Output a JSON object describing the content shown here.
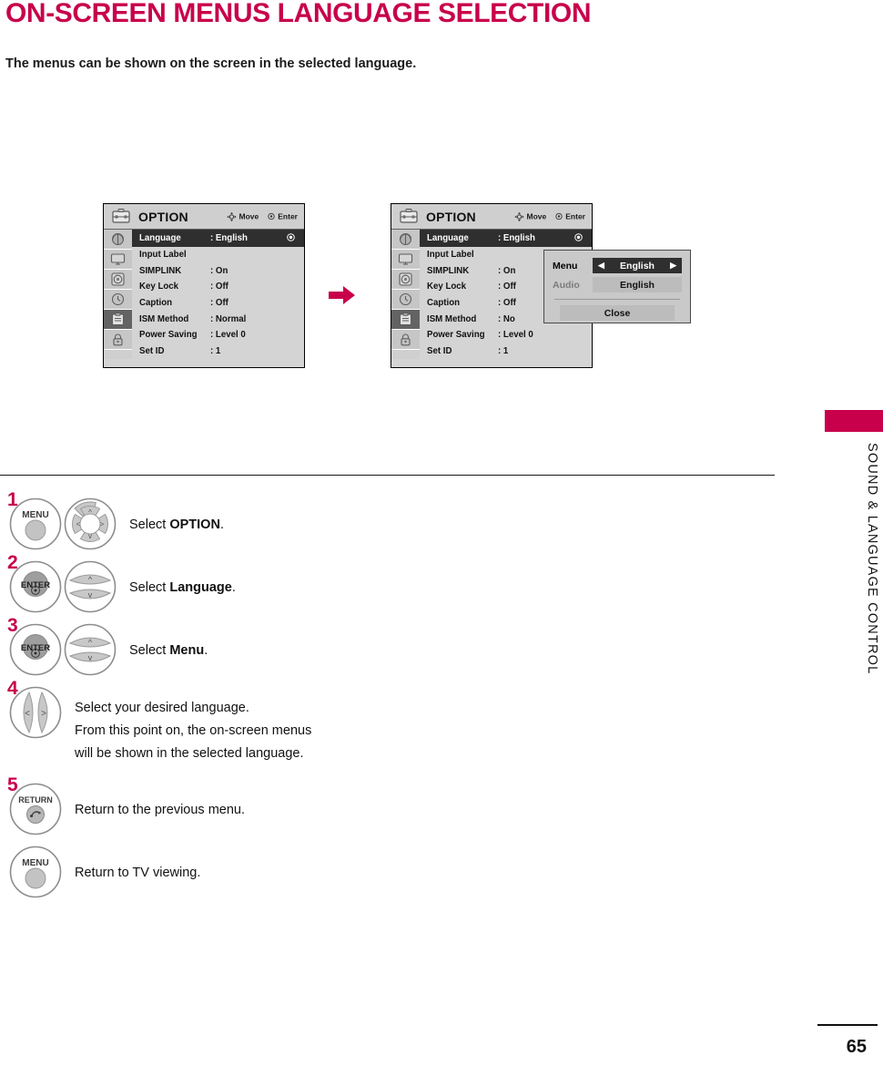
{
  "page": {
    "title": "ON-SCREEN MENUS LANGUAGE SELECTION",
    "subtitle": "The menus can be shown on the screen in the selected language.",
    "side_tab_text": "SOUND & LANGUAGE CONTROL",
    "page_number": "65",
    "accent_color": "#c8004b"
  },
  "osd": {
    "title": "OPTION",
    "hints": {
      "move": "Move",
      "enter": "Enter"
    },
    "rail_icons": [
      "picture-icon",
      "screen-icon",
      "audio-icon",
      "time-icon",
      "option-icon",
      "lock-icon"
    ],
    "rows": [
      {
        "label": "Language",
        "value": ": English",
        "highlighted": true
      },
      {
        "label": "Input Label",
        "value": "",
        "highlighted": false
      },
      {
        "label": "SIMPLINK",
        "value": ": On",
        "highlighted": false
      },
      {
        "label": "Key Lock",
        "value": ": Off",
        "highlighted": false
      },
      {
        "label": "Caption",
        "value": ": Off",
        "highlighted": false
      },
      {
        "label": "ISM Method",
        "value": ": Normal",
        "highlighted": false
      },
      {
        "label": "Power Saving",
        "value": ": Level 0",
        "highlighted": false
      },
      {
        "label": "Set ID",
        "value": ": 1",
        "highlighted": false
      }
    ],
    "rows_right": [
      {
        "label": "Language",
        "value": ": English",
        "highlighted": true
      },
      {
        "label": "Input Label",
        "value": "",
        "highlighted": false
      },
      {
        "label": "SIMPLINK",
        "value": ": On",
        "highlighted": false
      },
      {
        "label": "Key Lock",
        "value": ": Off",
        "highlighted": false
      },
      {
        "label": "Caption",
        "value": ": Off",
        "highlighted": false
      },
      {
        "label": "ISM Method",
        "value": ": No",
        "highlighted": false
      },
      {
        "label": "Power Saving",
        "value": ": Level 0",
        "highlighted": false
      },
      {
        "label": "Set ID",
        "value": ": 1",
        "highlighted": false
      }
    ]
  },
  "popup": {
    "menu_label": "Menu",
    "menu_value": "English",
    "audio_label": "Audio",
    "audio_value": "English",
    "close_label": "Close",
    "left_arrow": "◀",
    "right_arrow": "▶"
  },
  "steps": [
    {
      "num": "1",
      "buttons": [
        "MENU",
        "nav-wheel-4way"
      ],
      "text_prefix": "Select ",
      "text_bold": "OPTION",
      "text_suffix": "."
    },
    {
      "num": "2",
      "buttons": [
        "ENTER",
        "nav-updown"
      ],
      "text_prefix": "Select ",
      "text_bold": "Language",
      "text_suffix": "."
    },
    {
      "num": "3",
      "buttons": [
        "ENTER",
        "nav-updown"
      ],
      "text_prefix": "Select ",
      "text_bold": "Menu",
      "text_suffix": "."
    },
    {
      "num": "4",
      "buttons": [
        "nav-leftright"
      ],
      "line1": "Select your desired language.",
      "line2": "From this point on, the on-screen menus",
      "line3": "will be shown in the selected language."
    },
    {
      "num": "5",
      "buttons": [
        "RETURN"
      ],
      "text": "Return to the previous menu."
    },
    {
      "num": "",
      "buttons": [
        "MENU"
      ],
      "text": "Return to TV viewing."
    }
  ],
  "labels": {
    "menu_button": "MENU",
    "enter_button": "ENTER",
    "return_button": "RETURN"
  }
}
